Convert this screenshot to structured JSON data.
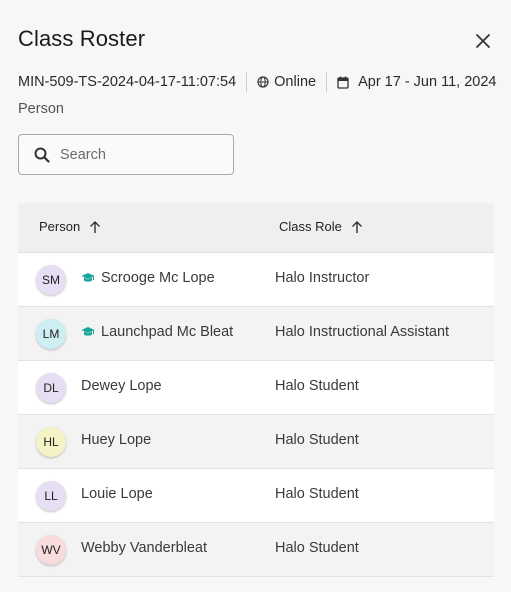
{
  "dialog": {
    "title": "Class Roster",
    "close_icon": "close-icon"
  },
  "meta": {
    "class_code": "MIN-509-TS-2024-04-17-11:07:54",
    "modality": "Online",
    "modality_icon": "globe-icon",
    "date_range": "Apr 17 - Jun 11, 2024",
    "date_icon": "calendar-icon"
  },
  "subtitle": "Person",
  "search": {
    "placeholder": "Search",
    "value": "",
    "icon": "search-icon"
  },
  "table": {
    "columns": [
      {
        "label": "Person",
        "sort": "ascending"
      },
      {
        "label": "Class Role",
        "sort": "ascending"
      }
    ],
    "rows": [
      {
        "initials": "SM",
        "avatar_color": "#e6def3",
        "instructor_badge": true,
        "name": "Scrooge Mc Lope",
        "role": "Halo Instructor"
      },
      {
        "initials": "LM",
        "avatar_color": "#cdeff4",
        "instructor_badge": true,
        "name": "Launchpad Mc Bleat",
        "role": "Halo Instructional Assistant"
      },
      {
        "initials": "DL",
        "avatar_color": "#e6def3",
        "instructor_badge": false,
        "name": "Dewey Lope",
        "role": "Halo Student"
      },
      {
        "initials": "HL",
        "avatar_color": "#f3f3c6",
        "instructor_badge": false,
        "name": "Huey Lope",
        "role": "Halo Student"
      },
      {
        "initials": "LL",
        "avatar_color": "#e6def3",
        "instructor_badge": false,
        "name": "Louie Lope",
        "role": "Halo Student"
      },
      {
        "initials": "WV",
        "avatar_color": "#f8dbdb",
        "instructor_badge": false,
        "name": "Webby Vanderbleat",
        "role": "Halo Student"
      }
    ]
  },
  "colors": {
    "instructor_badge": "#1aa39a",
    "background": "#f7f7f7"
  }
}
